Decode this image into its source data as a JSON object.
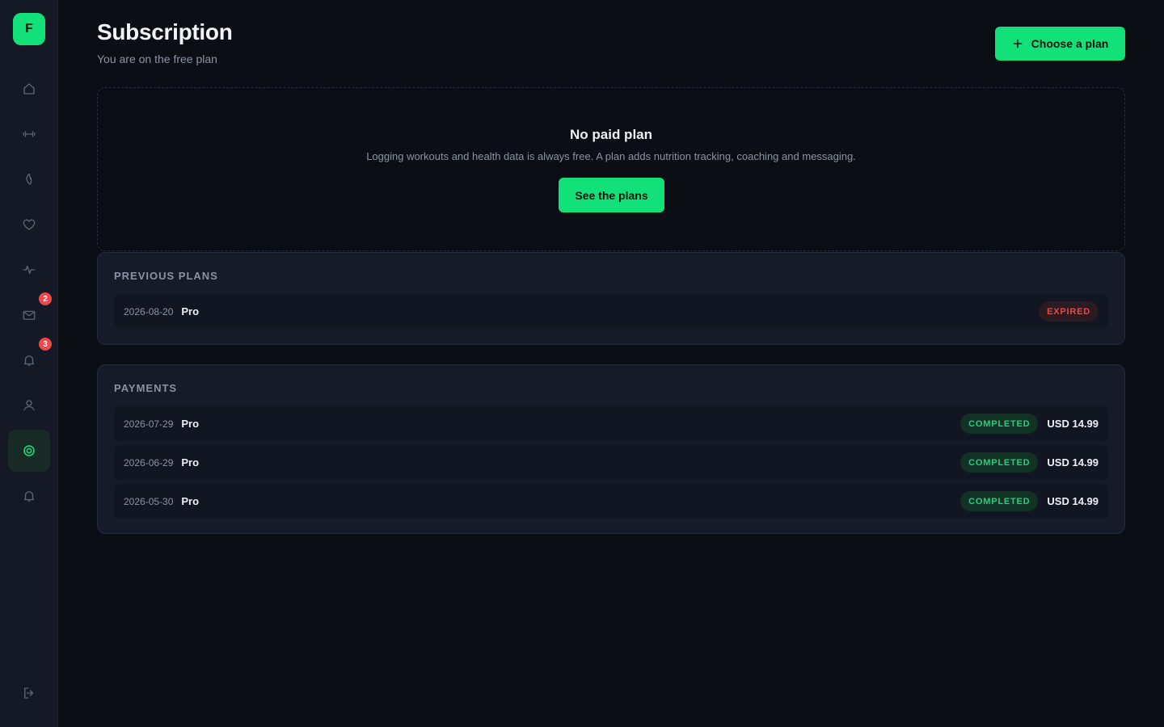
{
  "sidebar": {
    "logo_letter": "F",
    "items": [
      {
        "icon": "home-icon"
      },
      {
        "icon": "dumbbell-icon"
      },
      {
        "icon": "leaf-icon"
      },
      {
        "icon": "heart-icon"
      },
      {
        "icon": "activity-icon"
      },
      {
        "icon": "mail-icon",
        "badge": "2"
      },
      {
        "icon": "bell-icon",
        "badge": "3"
      },
      {
        "icon": "user-icon"
      },
      {
        "icon": "target-icon",
        "active": true
      },
      {
        "icon": "bell-icon"
      }
    ],
    "logout_icon": "logout-icon"
  },
  "header": {
    "title": "Subscription",
    "subtitle": "You are on the free plan",
    "choose_label": "Choose a plan"
  },
  "empty_plan": {
    "title": "No paid plan",
    "description": "Logging workouts and health data is always free. A plan adds nutrition tracking, coaching and messaging.",
    "button_label": "See the plans"
  },
  "previous_plans": {
    "title": "PREVIOUS PLANS",
    "rows": [
      {
        "date": "2026-08-20",
        "plan": "Pro",
        "status": "EXPIRED"
      }
    ]
  },
  "payments": {
    "title": "PAYMENTS",
    "rows": [
      {
        "date": "2026-07-29",
        "plan": "Pro",
        "status": "COMPLETED",
        "amount": "USD 14.99"
      },
      {
        "date": "2026-06-29",
        "plan": "Pro",
        "status": "COMPLETED",
        "amount": "USD 14.99"
      },
      {
        "date": "2026-05-30",
        "plan": "Pro",
        "status": "COMPLETED",
        "amount": "USD 14.99"
      }
    ]
  },
  "colors": {
    "accent": "#12e17a",
    "background": "#0b0e14",
    "sidebar": "#141925",
    "panel": "#151b28",
    "expired": "#e04b4b",
    "completed": "#1fd37c",
    "badge": "#f04848"
  }
}
